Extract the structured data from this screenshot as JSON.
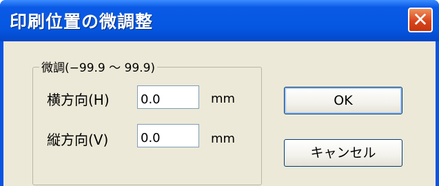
{
  "window": {
    "title": "印刷位置の微調整",
    "close_glyph": "✕",
    "colors": {
      "titlebar": "#0556e0",
      "client": "#ece9d8",
      "close": "#d8451c"
    }
  },
  "adjust_group": {
    "legend": "微調(−99.9 ～ 99.9)",
    "horizontal": {
      "label": "横方向(H)",
      "value": "0.0",
      "unit": "mm"
    },
    "vertical": {
      "label": "縦方向(V)",
      "value": "0.0",
      "unit": "mm"
    }
  },
  "buttons": {
    "ok": "OK",
    "cancel": "キャンセル"
  },
  "icons": [
    "close-icon"
  ]
}
